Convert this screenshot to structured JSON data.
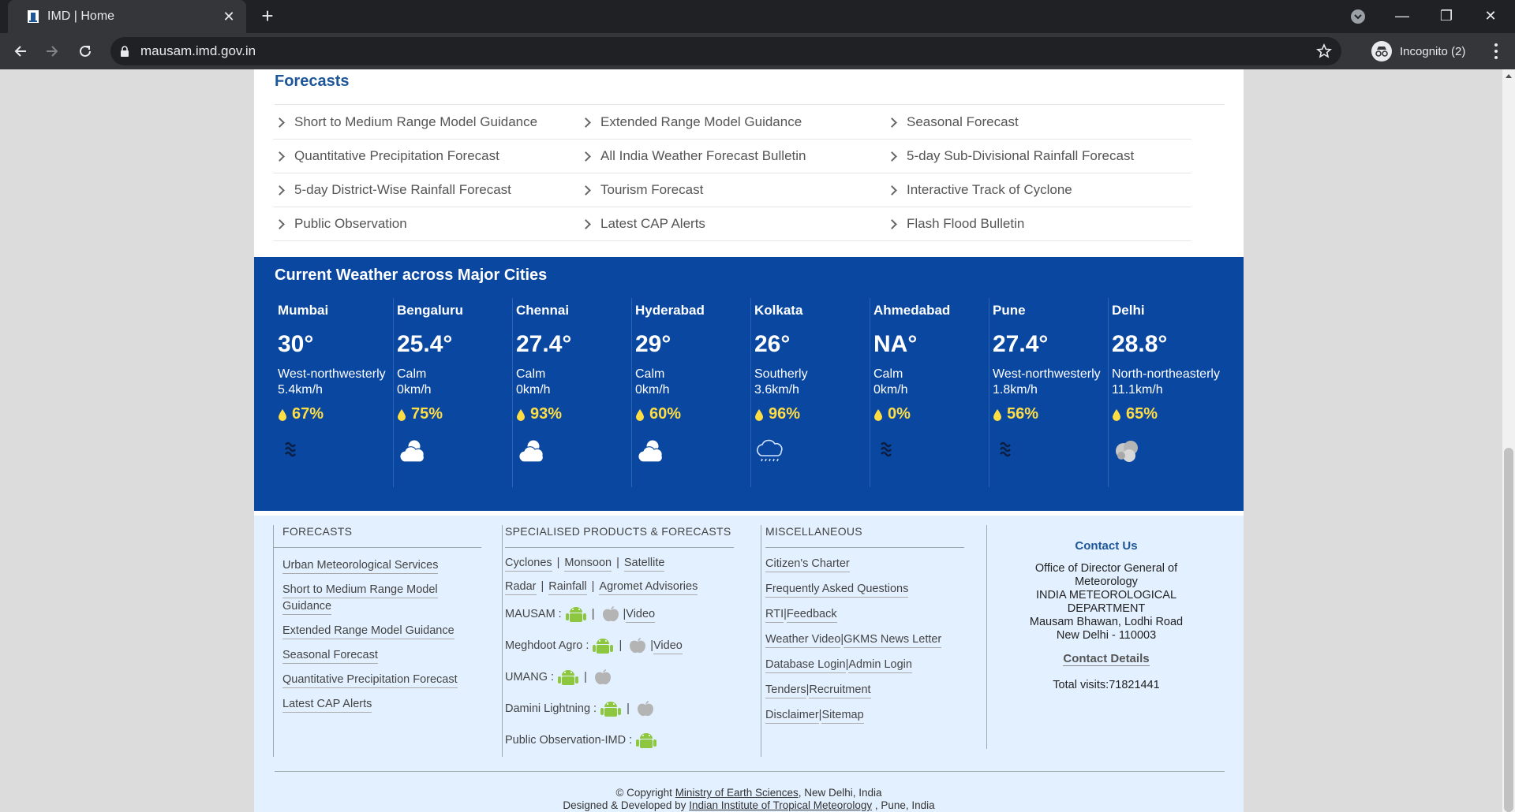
{
  "browser": {
    "tab_title": "IMD | Home",
    "url": "mausam.imd.gov.in",
    "incognito_label": "Incognito (2)"
  },
  "forecasts": {
    "title": "Forecasts",
    "items": [
      "Short to Medium Range Model Guidance",
      "Extended Range Model Guidance",
      "Seasonal Forecast",
      "Quantitative Precipitation Forecast",
      "All India Weather Forecast Bulletin",
      "5-day Sub-Divisional Rainfall Forecast",
      "5-day District-Wise Rainfall Forecast",
      "Tourism Forecast",
      "Interactive Track of Cyclone",
      "Public Observation",
      "Latest CAP Alerts",
      "Flash Flood Bulletin"
    ]
  },
  "weather": {
    "title": "Current Weather across Major Cities",
    "cities": [
      {
        "name": "Mumbai",
        "temp": "30°",
        "wind": "West-northwesterly",
        "speed": "5.4km/h",
        "humidity": "67%",
        "icon": "haze-icon"
      },
      {
        "name": "Bengaluru",
        "temp": "25.4°",
        "wind": "Calm",
        "speed": "0km/h",
        "humidity": "75%",
        "icon": "partly-cloudy-icon"
      },
      {
        "name": "Chennai",
        "temp": "27.4°",
        "wind": "Calm",
        "speed": "0km/h",
        "humidity": "93%",
        "icon": "partly-cloudy-icon"
      },
      {
        "name": "Hyderabad",
        "temp": "29°",
        "wind": "Calm",
        "speed": "0km/h",
        "humidity": "60%",
        "icon": "partly-cloudy-icon"
      },
      {
        "name": "Kolkata",
        "temp": "26°",
        "wind": "Southerly",
        "speed": "3.6km/h",
        "humidity": "96%",
        "icon": "drizzle-icon"
      },
      {
        "name": "Ahmedabad",
        "temp": "NA°",
        "wind": "Calm",
        "speed": "0km/h",
        "humidity": "0%",
        "icon": "haze-icon"
      },
      {
        "name": "Pune",
        "temp": "27.4°",
        "wind": "West-northwesterly",
        "speed": "1.8km/h",
        "humidity": "56%",
        "icon": "haze-icon"
      },
      {
        "name": "Delhi",
        "temp": "28.8°",
        "wind": "North-northeasterly",
        "speed": "11.1km/h",
        "humidity": "65%",
        "icon": "smoke-icon"
      }
    ]
  },
  "footer": {
    "col1": {
      "title": "FORECASTS",
      "links": [
        "Urban Meteorological Services",
        "Short to Medium Range Model",
        "Guidance",
        "Extended Range Model Guidance",
        "Seasonal Forecast",
        "Quantitative Precipitation Forecast",
        "Latest CAP Alerts"
      ]
    },
    "col2": {
      "title": "SPECIALISED PRODUCTS & FORECASTS",
      "cyclones": "Cyclones",
      "monsoon": "Monsoon",
      "satellite": "Satellite",
      "radar": "Radar",
      "rainfall": "Rainfall",
      "agromet": "Agromet Advisories",
      "mausam": "MAUSAM :",
      "meghdoot": "Meghdoot Agro :",
      "umang": "UMANG :",
      "damini": "Damini Lightning :",
      "public_obs": "Public Observation-IMD :",
      "video": "Video"
    },
    "col3": {
      "title": "MISCELLANEOUS",
      "citizens": "Citizen's Charter",
      "faq": "Frequently Asked Questions",
      "rti": "RTI",
      "feedback": "Feedback",
      "weather_video": "Weather Video",
      "gkms": "GKMS News Letter",
      "database": "Database Login",
      "admin": "Admin Login",
      "tenders": "Tenders",
      "recruitment": "Recruitment",
      "disclaimer": "Disclaimer",
      "sitemap": "Sitemap"
    },
    "contact": {
      "title": "Contact Us",
      "line1": "Office of Director General of",
      "line2": "Meteorology",
      "line3": "INDIA METEOROLOGICAL",
      "line4": "DEPARTMENT",
      "line5": "Mausam Bhawan, Lodhi Road",
      "line6": "New Delhi - 110003",
      "details": "Contact Details",
      "visits": "Total visits:71821441"
    },
    "copyright_prefix": "© Copyright",
    "copyright_link": "Ministry of Earth Sciences",
    "copyright_suffix": ", New Delhi, India",
    "designed_prefix": "Designed & Developed by",
    "designed_link": "Indian Institute of Tropical Meteorology",
    "designed_suffix": ", Pune, India"
  }
}
